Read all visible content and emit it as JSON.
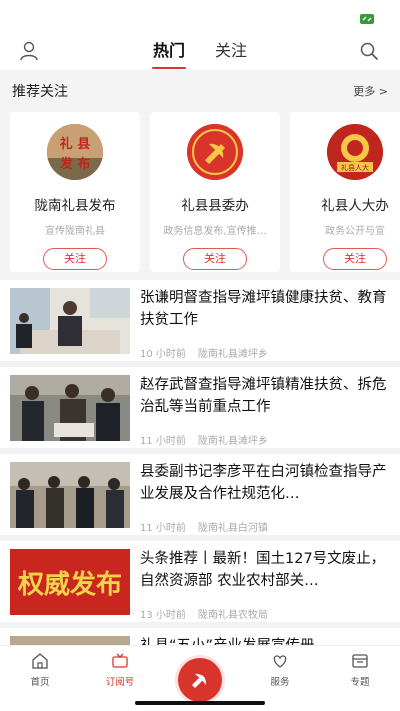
{
  "colors": {
    "accent": "#d9342b",
    "status_green": "#3a9a3a"
  },
  "top_nav": {
    "left_icon": "user-icon",
    "right_icon": "search-icon",
    "tabs": [
      {
        "label": "热门",
        "active": true
      },
      {
        "label": "关注",
        "active": false
      }
    ]
  },
  "recommend": {
    "title": "推荐关注",
    "more": "更多 >",
    "cards": [
      {
        "name": "陇南礼县发布",
        "desc": "宣传陇南礼县",
        "button": "关注",
        "logo_text": "礼县发布"
      },
      {
        "name": "礼县县委办",
        "desc": "政务信息发布,宣传推…",
        "button": "关注"
      },
      {
        "name": "礼县人大办",
        "desc": "政务公开与宣",
        "button": "关注",
        "logo_text": "礼县人大"
      }
    ]
  },
  "feed": [
    {
      "title": "张谦明督查指导滩坪镇健康扶贫、教育扶贫工作",
      "time": "10 小时前",
      "source": "陇南礼县滩坪乡"
    },
    {
      "title": "赵存武督查指导滩坪镇精准扶贫、拆危治乱等当前重点工作",
      "time": "11 小时前",
      "source": "陇南礼县滩坪乡"
    },
    {
      "title": "县委副书记李彦平在白河镇检查指导产业发展及合作社规范化…",
      "time": "11 小时前",
      "source": "陇南礼县白河镇"
    },
    {
      "title": "头条推荐丨最新！国土127号文废止，自然资源部 农业农村部关…",
      "time": "13 小时前",
      "source": "陇南礼县农牧局",
      "thumb_text": "权威发布"
    },
    {
      "title": "礼县“五小”产业发展宣传册"
    }
  ],
  "tabbar": {
    "items": [
      {
        "label": "首页",
        "icon": "home-icon"
      },
      {
        "label": "订阅号",
        "icon": "tv-icon",
        "active": true
      },
      {
        "label": "服务",
        "icon": "heart-icon"
      },
      {
        "label": "专题",
        "icon": "topic-icon"
      }
    ],
    "center_icon": "party-emblem-icon"
  }
}
